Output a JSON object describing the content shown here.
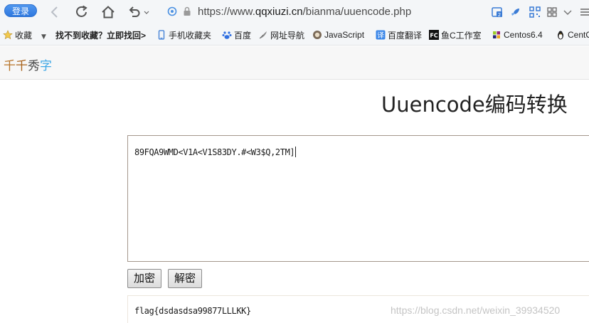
{
  "browser": {
    "login_label": "登录",
    "url_prefix": "https://www.",
    "url_domain": "qqxiuzi.cn",
    "url_path": "/bianma/uuencode.php",
    "badge_count": "2"
  },
  "bookmarks": {
    "items": [
      {
        "label": "收藏",
        "icon": "star-icon"
      },
      {
        "label": "找不到收藏？立即找回>",
        "icon": ""
      },
      {
        "label": "手机收藏夹",
        "icon": "phone-icon"
      },
      {
        "label": "百度",
        "icon": "baidu-paw-icon"
      },
      {
        "label": "网址导航",
        "icon": "feather-icon"
      },
      {
        "label": "JavaScript",
        "icon": "js-icon"
      },
      {
        "label": "百度翻译",
        "icon": "translate-icon"
      },
      {
        "label": "鱼C工作室",
        "icon": "fishc-icon"
      },
      {
        "label": "Centos6.4",
        "icon": "centos-icon"
      },
      {
        "label": "CentO",
        "icon": "linux-icon"
      }
    ]
  },
  "site": {
    "logo": [
      "千",
      "千",
      "秀",
      "字"
    ],
    "page_title": "Uuencode编码转换"
  },
  "editor": {
    "input_value": "89FQA9WMD<V1A<V1S83DY.#<W3$Q,2TM]",
    "encode_label": "加密",
    "decode_label": "解密",
    "output_value": "flag{dsdasdsa99877LLLKK}"
  },
  "watermark": "https://blog.csdn.net/weixin_39934520",
  "colors": {
    "login_button": "#3a86e8",
    "logo_brown": "#a8621b",
    "logo_blue": "#3ea7e6",
    "textarea_border": "#a4978c"
  }
}
